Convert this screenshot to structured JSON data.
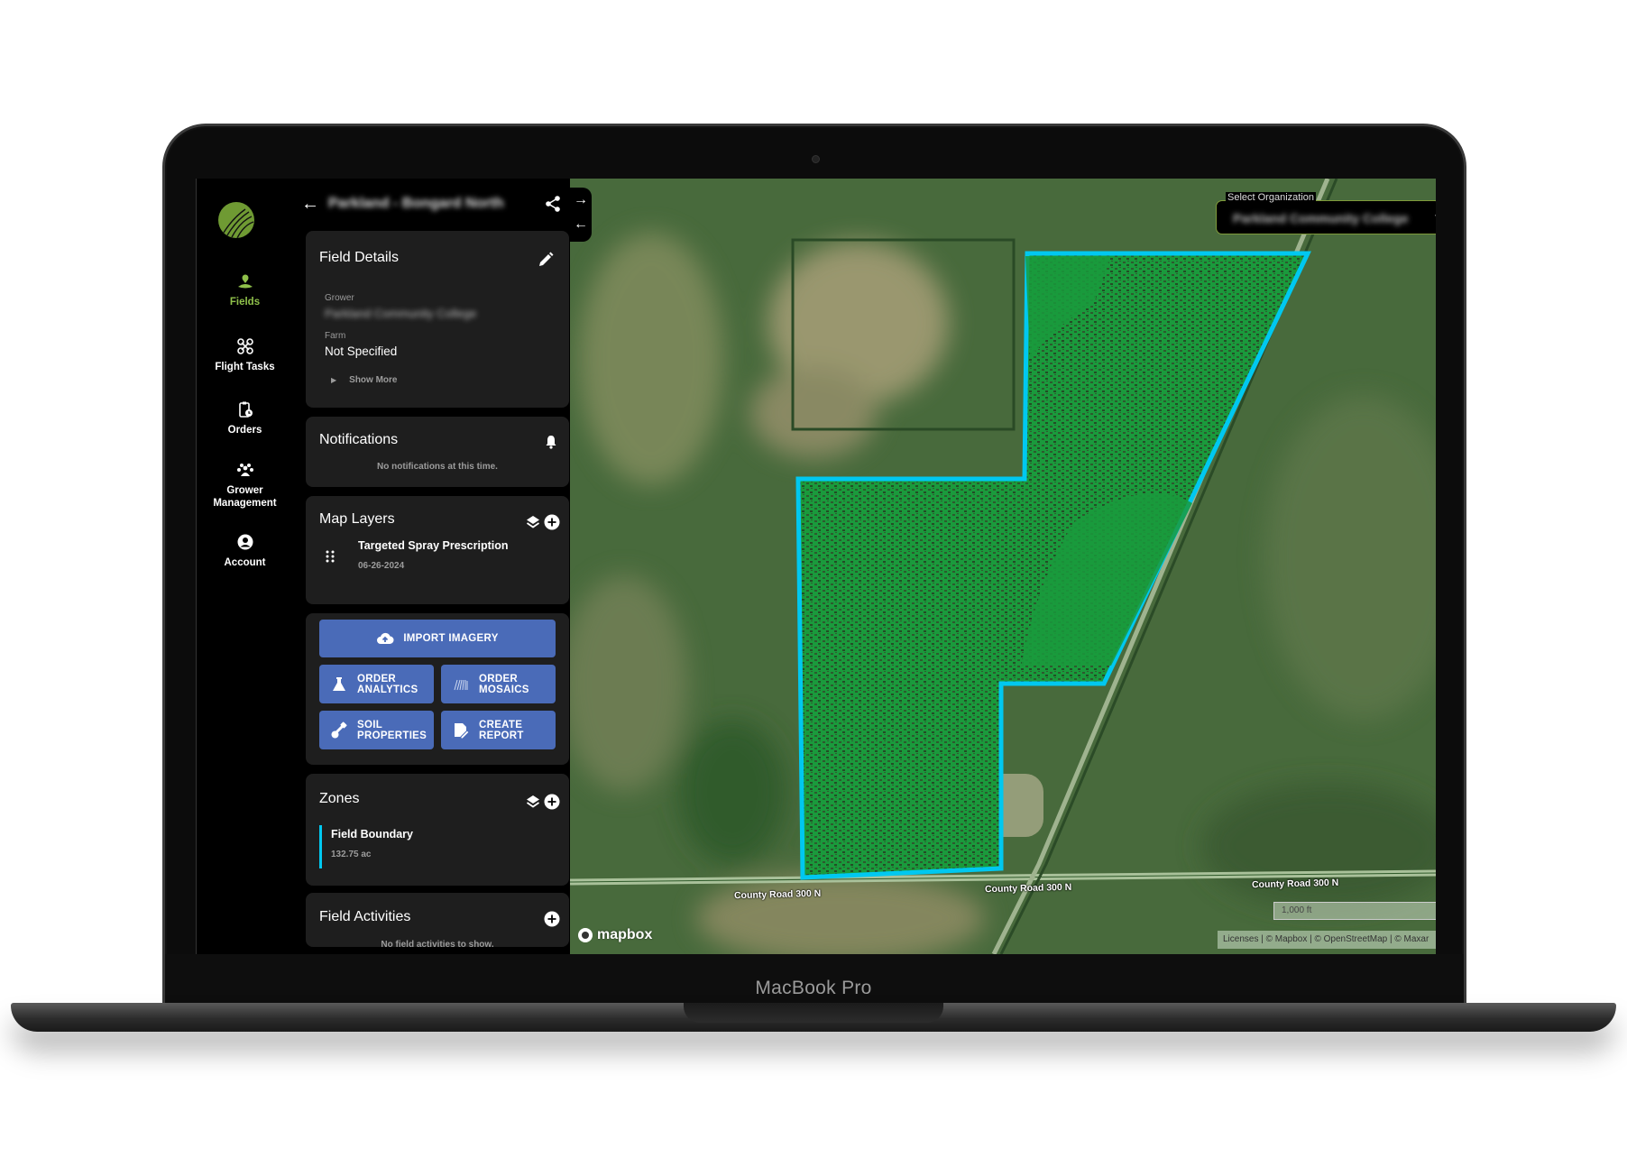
{
  "device": {
    "brand_label": "MacBook Pro"
  },
  "nav": {
    "items": [
      {
        "label": "Fields",
        "icon": "map-pin-icon",
        "active": true
      },
      {
        "label": "Flight Tasks",
        "icon": "drone-icon"
      },
      {
        "label": "Orders",
        "icon": "clipboard-clock-icon"
      },
      {
        "label": "Grower",
        "label2": "Management",
        "icon": "group-icon"
      },
      {
        "label": "Account",
        "icon": "account-circle-icon"
      }
    ]
  },
  "header": {
    "back_icon": "←",
    "field_name": "Parkland - Bongard North",
    "share_icon": "share-icon"
  },
  "field_details": {
    "title": "Field Details",
    "grower_label": "Grower",
    "grower_value": "Parkland Community College",
    "farm_label": "Farm",
    "farm_value": "Not Specified",
    "show_more": "Show More"
  },
  "notifications": {
    "title": "Notifications",
    "empty": "No notifications at this time."
  },
  "map_layers": {
    "title": "Map Layers",
    "items": [
      {
        "name": "Targeted Spray Prescription",
        "date": "06-26-2024"
      }
    ]
  },
  "actions": {
    "import": "IMPORT IMAGERY",
    "order_analytics_1": "ORDER",
    "order_analytics_2": "ANALYTICS",
    "order_mosaics_1": "ORDER",
    "order_mosaics_2": "MOSAICS",
    "soil_1": "SOIL",
    "soil_2": "PROPERTIES",
    "report_1": "CREATE",
    "report_2": "REPORT"
  },
  "zones": {
    "title": "Zones",
    "items": [
      {
        "name": "Field Boundary",
        "area": "132.75 ac",
        "color": "#00c8f0"
      }
    ]
  },
  "field_activities": {
    "title": "Field Activities",
    "empty": "No field activities to show."
  },
  "map": {
    "org_label": "Select Organization",
    "org_value": "Parkland Community College",
    "roads": [
      "County Road 300 N",
      "County Road 300 N",
      "County Road 300 N"
    ],
    "scale": "1,000 ft",
    "attribution": "Licenses | © Mapbox | © OpenStreetMap | © Maxar",
    "logo": "mapbox",
    "boundary_color": "#00c8f0",
    "fill_color": "#1a9a3c"
  },
  "colors": {
    "accent": "#8fc04a",
    "button": "#4a6bb8",
    "card": "#1e1e1e"
  }
}
